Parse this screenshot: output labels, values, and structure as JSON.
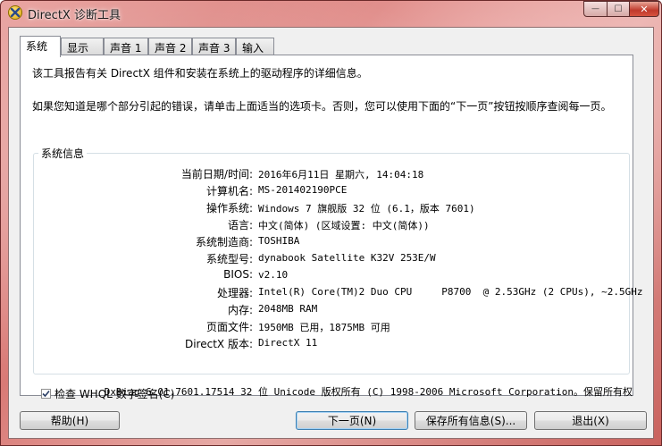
{
  "window": {
    "title": "DirectX 诊断工具",
    "controls": {
      "minimize": "—",
      "maximize": "☐",
      "close": "✕"
    }
  },
  "tabs": [
    {
      "label": "系统",
      "active": true
    },
    {
      "label": "显示",
      "active": false
    },
    {
      "label": "声音 1",
      "active": false
    },
    {
      "label": "声音 2",
      "active": false
    },
    {
      "label": "声音 3",
      "active": false
    },
    {
      "label": "输入",
      "active": false
    }
  ],
  "panel": {
    "intro1": "该工具报告有关 DirectX 组件和安装在系统上的驱动程序的详细信息。",
    "intro2": "如果您知道是哪个部分引起的错误，请单击上面适当的选项卡。否则，您可以使用下面的“下一页”按钮按顺序查阅每一页。",
    "group_title": "系统信息",
    "rows": [
      {
        "label": "当前日期/时间:",
        "value": "2016年6月11日 星期六, 14:04:18"
      },
      {
        "label": "计算机名:",
        "value": "MS-201402190PCE"
      },
      {
        "label": "操作系统:",
        "value": "Windows 7 旗舰版 32 位 (6.1，版本 7601)"
      },
      {
        "label": "语言:",
        "value": "中文(简体) (区域设置: 中文(简体))"
      },
      {
        "label": "系统制造商:",
        "value": "TOSHIBA"
      },
      {
        "label": "系统型号:",
        "value": "dynabook Satellite K32V 253E/W"
      },
      {
        "label": "BIOS:",
        "value": "v2.10"
      },
      {
        "label": "处理器:",
        "value": "Intel(R) Core(TM)2 Duo CPU     P8700  @ 2.53GHz (2 CPUs), ~2.5GHz"
      },
      {
        "label": "内存:",
        "value": "2048MB RAM"
      },
      {
        "label": "页面文件:",
        "value": "1950MB 已用，1875MB 可用"
      },
      {
        "label": "DirectX 版本:",
        "value": "DirectX 11"
      }
    ],
    "whql_checkbox": {
      "label": "检查 WHQL 数字签名(C)",
      "checked": true
    },
    "copyright": "DxDiag 6.01.7601.17514 32 位 Unicode 版权所有 (C) 1998-2006 Microsoft Corporation。保留所有权"
  },
  "buttons": {
    "help": "帮助(H)",
    "next": "下一页(N)",
    "save_all": "保存所有信息(S)...",
    "exit": "退出(X)"
  }
}
